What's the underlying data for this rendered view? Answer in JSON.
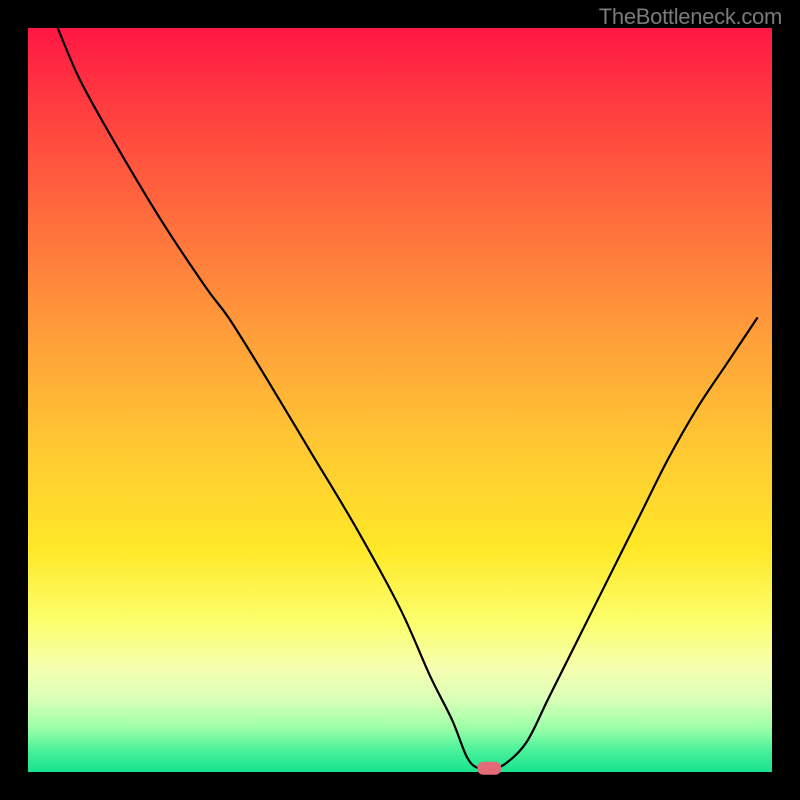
{
  "watermark": "TheBottleneck.com",
  "chart_data": {
    "type": "line",
    "title": "",
    "xlabel": "",
    "ylabel": "",
    "xlim": [
      0,
      100
    ],
    "ylim": [
      0,
      100
    ],
    "grid": false,
    "legend": false,
    "background_gradient": {
      "type": "vertical",
      "stops": [
        {
          "offset": 0.0,
          "color": "#ff1744"
        },
        {
          "offset": 0.1,
          "color": "#ff3b3f"
        },
        {
          "offset": 0.25,
          "color": "#ff6b3d"
        },
        {
          "offset": 0.4,
          "color": "#ff9a3a"
        },
        {
          "offset": 0.55,
          "color": "#ffc533"
        },
        {
          "offset": 0.7,
          "color": "#ffe828"
        },
        {
          "offset": 0.8,
          "color": "#fcff6e"
        },
        {
          "offset": 0.86,
          "color": "#f5ffb0"
        },
        {
          "offset": 0.9,
          "color": "#dcffb8"
        },
        {
          "offset": 0.94,
          "color": "#9effa8"
        },
        {
          "offset": 0.97,
          "color": "#4cf29a"
        },
        {
          "offset": 1.0,
          "color": "#18e28e"
        }
      ]
    },
    "series": [
      {
        "name": "bottleneck-curve",
        "color": "#000000",
        "x": [
          4,
          7,
          12,
          18,
          24,
          27,
          32,
          38,
          44,
          50,
          54,
          57,
          59,
          60.5,
          62,
          64,
          67,
          70,
          74,
          78,
          82,
          86,
          90,
          94,
          98
        ],
        "y": [
          100,
          93,
          84,
          74,
          65,
          61,
          53,
          43,
          33,
          22,
          13,
          7,
          2,
          0.5,
          0.5,
          1,
          4,
          10,
          18,
          26,
          34,
          42,
          49,
          55,
          61
        ]
      }
    ],
    "marker": {
      "x": 62,
      "y": 0.5,
      "color": "#e36b78",
      "shape": "rounded-rect"
    },
    "frame": {
      "color": "#000000",
      "inset": 28
    }
  }
}
